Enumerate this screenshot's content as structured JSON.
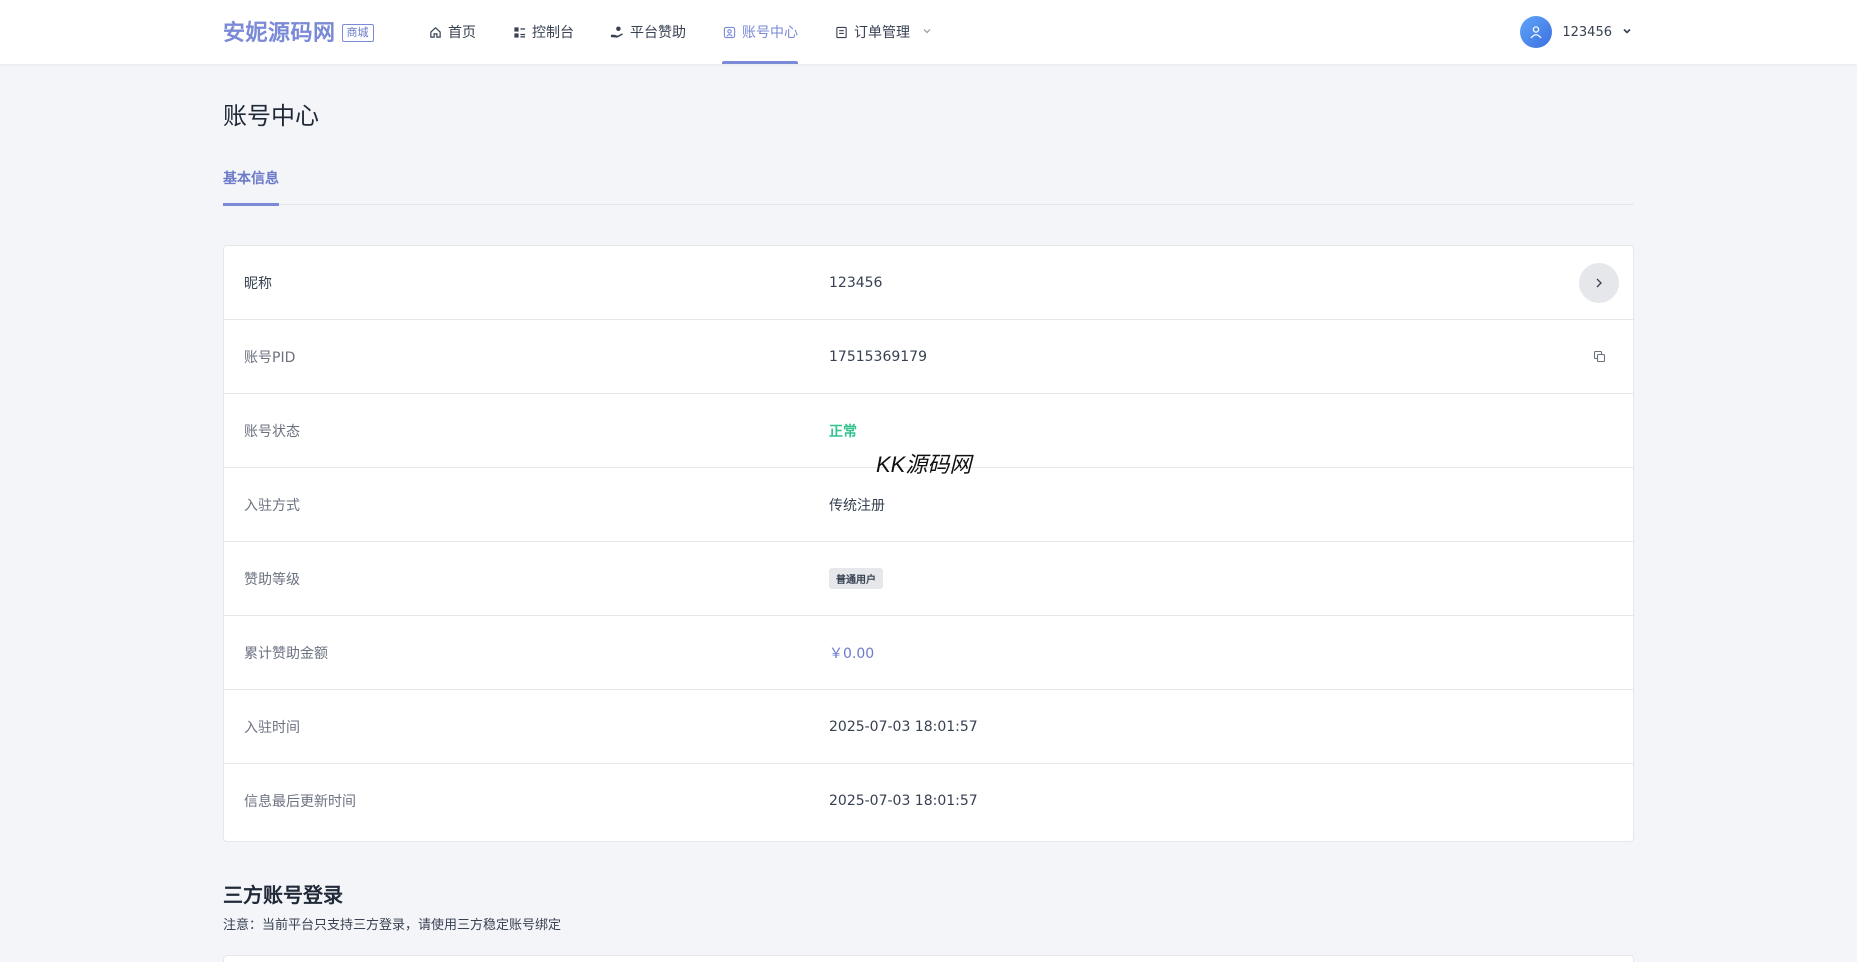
{
  "brand": {
    "name": "安妮源码网",
    "tag": "商城"
  },
  "nav": {
    "items": [
      {
        "label": "首页",
        "icon": "home-icon"
      },
      {
        "label": "控制台",
        "icon": "dashboard-icon"
      },
      {
        "label": "平台赞助",
        "icon": "donate-icon"
      },
      {
        "label": "账号中心",
        "icon": "account-icon",
        "active": true
      },
      {
        "label": "订单管理",
        "icon": "order-icon",
        "dropdown": true
      }
    ]
  },
  "user": {
    "name": "123456"
  },
  "page": {
    "title": "账号中心"
  },
  "tabs": [
    {
      "label": "基本信息",
      "active": true
    }
  ],
  "info": {
    "nickname": {
      "label": "昵称",
      "value": "123456"
    },
    "pid": {
      "label": "账号PID",
      "value": "17515369179"
    },
    "status": {
      "label": "账号状态",
      "value": "正常"
    },
    "join_method": {
      "label": "入驻方式",
      "value": "传统注册"
    },
    "level": {
      "label": "赞助等级",
      "value": "普通用户"
    },
    "total": {
      "label": "累计赞助金额",
      "value": "￥0.00"
    },
    "join_time": {
      "label": "入驻时间",
      "value": "2025-07-03 18:01:57"
    },
    "updated": {
      "label": "信息最后更新时间",
      "value": "2025-07-03 18:01:57"
    }
  },
  "watermark": "KK源码网",
  "third_party": {
    "title": "三方账号登录",
    "note": "注意：当前平台只支持三方登录，请使用三方稳定账号绑定"
  },
  "colors": {
    "accent": "#7a8ad6",
    "success": "#34c38f",
    "avatar": "#3b82f6"
  }
}
